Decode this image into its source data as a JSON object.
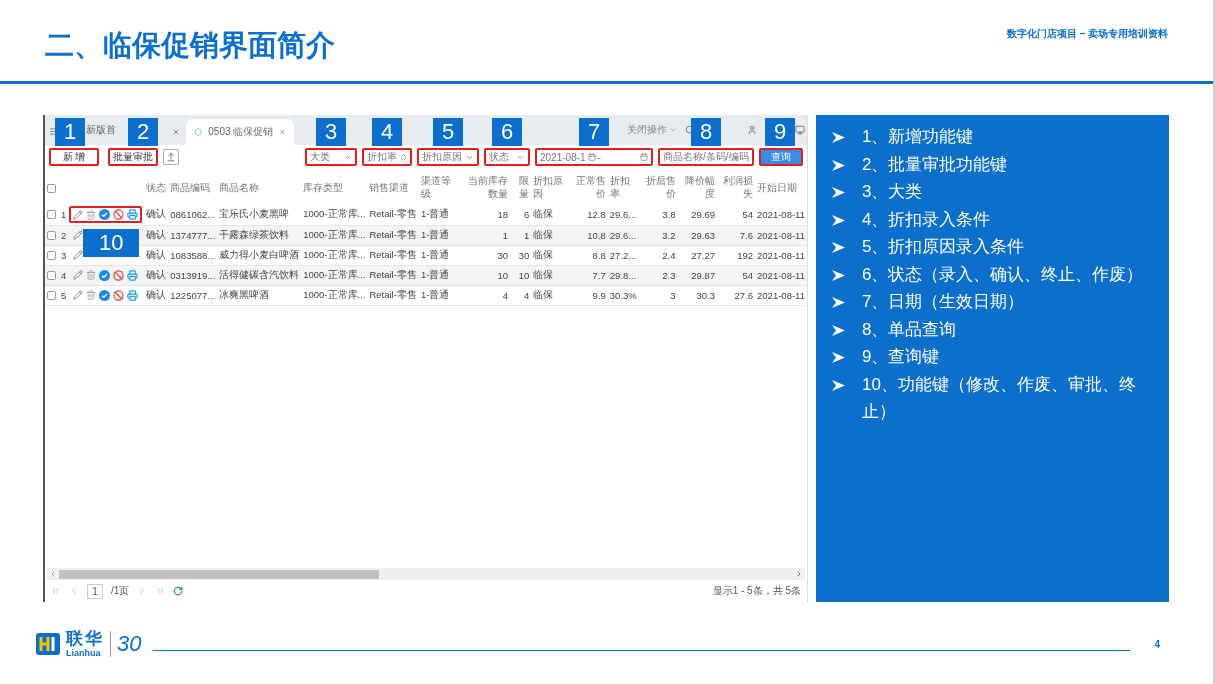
{
  "header": {
    "title": "二、临保促销界面简介",
    "subtitle": "数字化门店项目 – 卖场专用培训资料"
  },
  "app": {
    "tabs": [
      {
        "label": "新版首",
        "selected": false
      },
      {
        "label": "0503 临保促销",
        "selected": true
      }
    ],
    "top_menu": "关闭操作",
    "toolbar": {
      "add": {
        "label": "新 增",
        "callout": "1"
      },
      "batch": {
        "label": "批量审批",
        "callout": "2"
      },
      "filters": [
        {
          "kind": "select",
          "placeholder": "大类",
          "callout": "3"
        },
        {
          "kind": "spinner",
          "placeholder": "折扣率",
          "callout": "4"
        },
        {
          "kind": "select",
          "placeholder": "折扣原因",
          "callout": "5"
        },
        {
          "kind": "select",
          "placeholder": "状态",
          "callout": "6"
        },
        {
          "kind": "daterange",
          "value": "2021-08-1",
          "separator": "-",
          "callout": "7"
        },
        {
          "kind": "search",
          "placeholder": "商品名称/条码/编码",
          "callout": "8"
        }
      ],
      "query": {
        "label": "查询",
        "callout": "9"
      }
    },
    "table": {
      "header_checked": false,
      "columns": [
        "状态",
        "商品编码",
        "商品名称",
        "库存类型",
        "销售渠道",
        "渠道等级",
        "当前库存数量",
        "限量",
        "折扣原因",
        "正常售价",
        "折扣率",
        "折后售价",
        "降价幅度",
        "利润损失",
        "开始日期"
      ],
      "rows": [
        {
          "checked": false,
          "index": "1",
          "highlighted": true,
          "callout": "10",
          "cells": [
            "确认",
            "0861062...",
            "宝乐氏小麦黑啤",
            "1000-正常库...",
            "Retail-零售",
            "1-普通",
            "18",
            "6",
            "临保",
            "12.8",
            "29.6...",
            "3.8",
            "29.69",
            "54",
            "2021-08-11"
          ]
        },
        {
          "checked": false,
          "index": "2",
          "highlighted": false,
          "callout": "",
          "cells": [
            "确认",
            "1374777...",
            "干露森绿茶饮料",
            "1000-正常库...",
            "Retail-零售",
            "1-普通",
            "1",
            "1",
            "临保",
            "10.8",
            "29.6...",
            "3.2",
            "29.63",
            "7.6",
            "2021-08-11"
          ]
        },
        {
          "checked": false,
          "index": "3",
          "highlighted": false,
          "callout": "",
          "cells": [
            "确认",
            "1083588...",
            "威力得小麦白啤酒",
            "1000-正常库...",
            "Retail-零售",
            "1-普通",
            "30",
            "30",
            "临保",
            "8.8",
            "27.2...",
            "2.4",
            "27.27",
            "192",
            "2021-08-11"
          ]
        },
        {
          "checked": false,
          "index": "4",
          "highlighted": false,
          "callout": "",
          "cells": [
            "确认",
            "0313919...",
            "活得健碳含汽饮料",
            "1000-正常库...",
            "Retail-零售",
            "1-普通",
            "10",
            "10",
            "临保",
            "7.7",
            "29.8...",
            "2.3",
            "29.87",
            "54",
            "2021-08-11"
          ]
        },
        {
          "checked": false,
          "index": "5",
          "highlighted": false,
          "callout": "",
          "cells": [
            "确认",
            "1225077...",
            "冰爽黑啤酒",
            "1000-正常库...",
            "Retail-零售",
            "1-普通",
            "4",
            "4",
            "临保",
            "9.9",
            "30.3%",
            "3",
            "30.3",
            "27.6",
            "2021-08-11"
          ]
        }
      ]
    },
    "pager": {
      "page": "1",
      "total": "/1页",
      "summary": "显示1 - 5条，共 5条"
    }
  },
  "legend": [
    "1、新增功能键",
    "2、批量审批功能键",
    "3、大类",
    "4、折扣录入条件",
    "5、折扣原因录入条件",
    "6、状态（录入、确认、终止、作废）",
    "7、日期（生效日期）",
    "8、单品查询",
    "9、查询键",
    "10、功能键（修改、作废、审批、终止）"
  ],
  "footer": {
    "brand": "联华",
    "brand_latin": "Lianhua",
    "anniversary": "30",
    "page": "4"
  }
}
